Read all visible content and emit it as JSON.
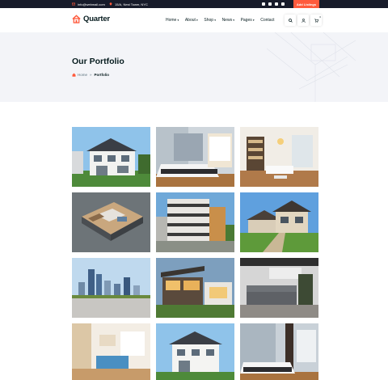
{
  "topbar": {
    "email": "info@webmail.com",
    "address": "15/A, Nest Tower, NYC",
    "add_listing_label": "Add Listings",
    "social_icons": [
      "facebook-icon",
      "twitter-icon",
      "linkedin-icon",
      "dribbble-icon"
    ]
  },
  "header": {
    "logo_text": "Quarter",
    "nav": [
      {
        "label": "Home",
        "has_dropdown": true
      },
      {
        "label": "About",
        "has_dropdown": true
      },
      {
        "label": "Shop",
        "has_dropdown": true
      },
      {
        "label": "News",
        "has_dropdown": true
      },
      {
        "label": "Pages",
        "has_dropdown": true
      },
      {
        "label": "Contact",
        "has_dropdown": false
      }
    ],
    "cart_count": "0",
    "icons": [
      "search-icon",
      "user-icon",
      "cart-icon"
    ]
  },
  "banner": {
    "title": "Our Portfolio",
    "breadcrumb_home": "Home",
    "breadcrumb_separator": "»",
    "breadcrumb_current": "Portfolio"
  },
  "portfolio": {
    "items": [
      {
        "subject": "white two-storey house"
      },
      {
        "subject": "bedroom interior"
      },
      {
        "subject": "living room with chandelier"
      },
      {
        "subject": "3D floor plan model"
      },
      {
        "subject": "modern apartment building"
      },
      {
        "subject": "suburban house with lawn"
      },
      {
        "subject": "city skyline"
      },
      {
        "subject": "modern villa at dusk"
      },
      {
        "subject": "grey sofa living room"
      },
      {
        "subject": "bright living room"
      },
      {
        "subject": "white house"
      },
      {
        "subject": "bedroom with wall panel"
      }
    ]
  },
  "colors": {
    "accent": "#ff5a3c",
    "topbar_bg": "#171b2a",
    "banner_bg": "#f3f4f8",
    "heading": "#071c1f"
  }
}
